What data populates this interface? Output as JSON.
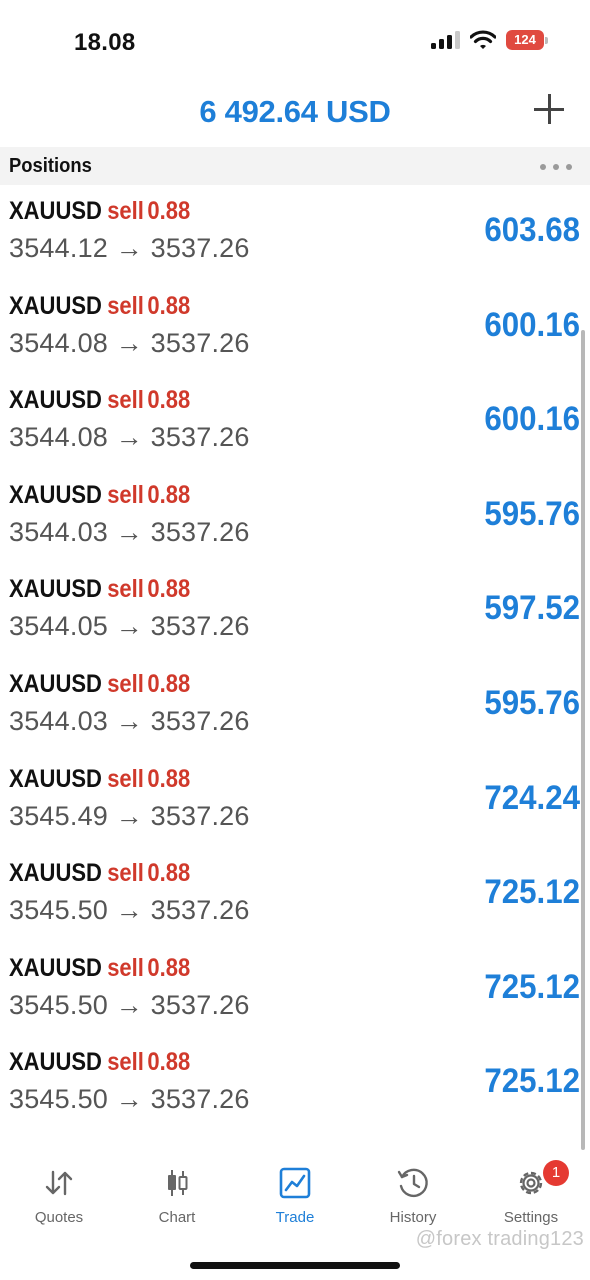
{
  "status_bar": {
    "time": "18.08",
    "battery": "124",
    "icons": [
      "cellular-signal-icon",
      "wifi-icon",
      "battery-charging-icon"
    ]
  },
  "header": {
    "balance": "6 492.64 USD",
    "add_icon": "plus-icon"
  },
  "section": {
    "title": "Positions",
    "more_icon": "more-dots-icon"
  },
  "positions": [
    {
      "symbol": "XAUUSD",
      "side": "sell",
      "volume": "0.88",
      "prices": "3544.12 → 3537.26",
      "profit": "603.68"
    },
    {
      "symbol": "XAUUSD",
      "side": "sell",
      "volume": "0.88",
      "prices": "3544.08 → 3537.26",
      "profit": "600.16"
    },
    {
      "symbol": "XAUUSD",
      "side": "sell",
      "volume": "0.88",
      "prices": "3544.08 → 3537.26",
      "profit": "600.16"
    },
    {
      "symbol": "XAUUSD",
      "side": "sell",
      "volume": "0.88",
      "prices": "3544.03 → 3537.26",
      "profit": "595.76"
    },
    {
      "symbol": "XAUUSD",
      "side": "sell",
      "volume": "0.88",
      "prices": "3544.05 → 3537.26",
      "profit": "597.52"
    },
    {
      "symbol": "XAUUSD",
      "side": "sell",
      "volume": "0.88",
      "prices": "3544.03 → 3537.26",
      "profit": "595.76"
    },
    {
      "symbol": "XAUUSD",
      "side": "sell",
      "volume": "0.88",
      "prices": "3545.49 → 3537.26",
      "profit": "724.24"
    },
    {
      "symbol": "XAUUSD",
      "side": "sell",
      "volume": "0.88",
      "prices": "3545.50 → 3537.26",
      "profit": "725.12"
    },
    {
      "symbol": "XAUUSD",
      "side": "sell",
      "volume": "0.88",
      "prices": "3545.50 → 3537.26",
      "profit": "725.12"
    },
    {
      "symbol": "XAUUSD",
      "side": "sell",
      "volume": "0.88",
      "prices": "3545.50 → 3537.26",
      "profit": "725.12"
    }
  ],
  "tabs": [
    {
      "label": "Quotes",
      "icon": "quotes-arrows-icon"
    },
    {
      "label": "Chart",
      "icon": "candlestick-chart-icon"
    },
    {
      "label": "Trade",
      "icon": "trade-chart-icon",
      "active": true
    },
    {
      "label": "History",
      "icon": "history-clock-icon"
    },
    {
      "label": "Settings",
      "icon": "gear-icon",
      "badge": "1"
    }
  ],
  "watermark": "@forex trading123",
  "colors": {
    "accent": "#1e7fd8",
    "sell": "#d0392b",
    "badge": "#e53a32"
  }
}
